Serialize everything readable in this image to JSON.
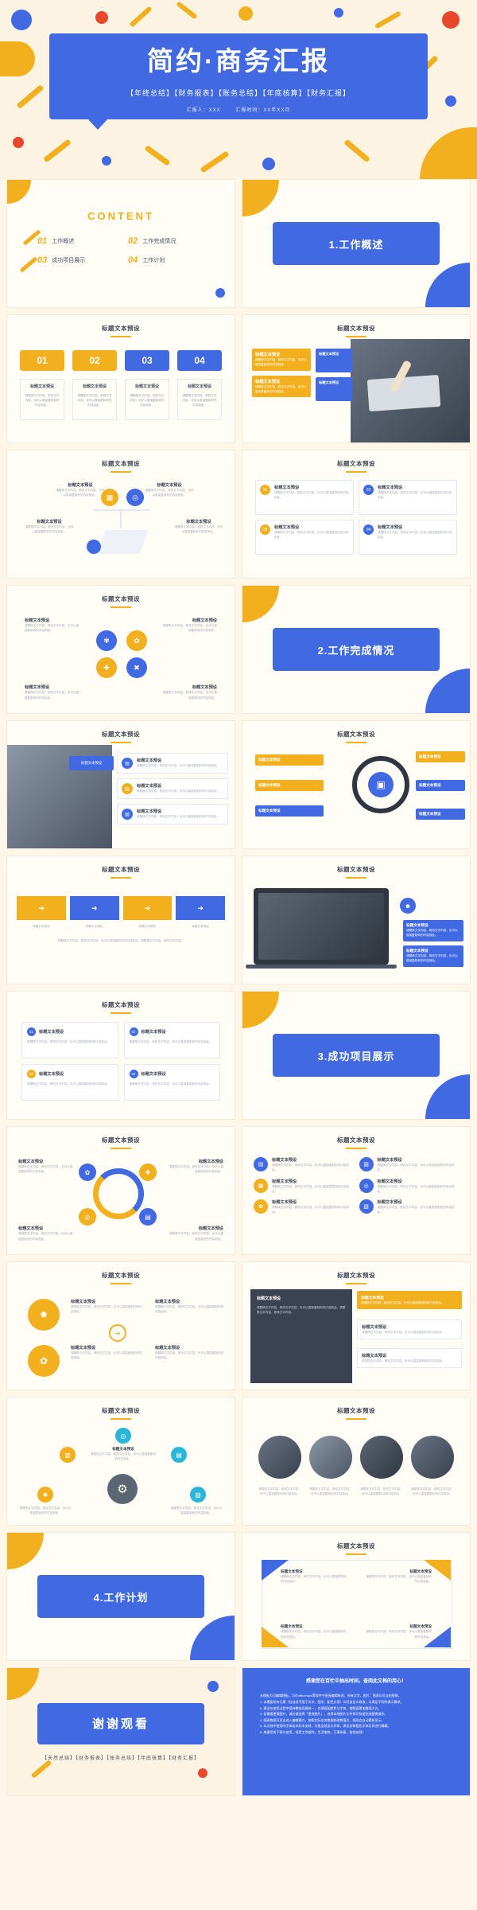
{
  "cover": {
    "title": "简约·商务汇报",
    "subtitle": "【年终总结】【财务报表】【账务总结】【年底核算】【财务汇报】",
    "meta_reporter": "汇报人：XXX",
    "meta_time": "汇报时间：XX年XX月"
  },
  "catalog": {
    "heading": "CONTENT",
    "items": [
      {
        "num": "01",
        "label": "工作概述"
      },
      {
        "num": "02",
        "label": "工作完成情况"
      },
      {
        "num": "03",
        "label": "成功项目展示"
      },
      {
        "num": "04",
        "label": "工作计划"
      }
    ]
  },
  "sections": [
    {
      "label": "1.工作概述"
    },
    {
      "label": "2.工作完成情况"
    },
    {
      "label": "3.成功项目展示"
    },
    {
      "label": "4.工作计划"
    }
  ],
  "slide_title": "标题文本预设",
  "body_text": "请替换文字内容，修改文字内容，也可以直接复制你的内容到此。请替换文字内容，修改文字内容。",
  "body_text_short": "请替换文字内容，修改文字内容，也可以直接复制你的内容到此。",
  "numbered": {
    "cards": [
      {
        "num": "01",
        "color": "#f2b01e",
        "label": "标题文本预设"
      },
      {
        "num": "02",
        "color": "#f2b01e",
        "label": "标题文本预设"
      },
      {
        "num": "03",
        "color": "#4069e2",
        "label": "标题文本预设"
      },
      {
        "num": "04",
        "color": "#4069e2",
        "label": "标题文本预设"
      }
    ]
  },
  "list_items": [
    {
      "num": "01",
      "label": "标题文本预设"
    },
    {
      "num": "02",
      "label": "标题文本预设"
    },
    {
      "num": "03",
      "label": "标题文本预设"
    },
    {
      "num": "04",
      "label": "标题文本预设"
    }
  ],
  "icons": {
    "chart": "chart-icon",
    "target": "target-icon",
    "gear": "gear-icon",
    "bulb": "bulb-icon",
    "cart": "cart-icon",
    "doc": "document-icon",
    "user": "user-icon",
    "lock": "lock-icon",
    "bank": "bank-icon",
    "arrow": "arrow-right-icon"
  },
  "thanks": {
    "title": "谢谢观看",
    "subtitle": "【天然总结】【财务报表】【账务总结】【年底核算】【财务汇报】"
  },
  "terms": {
    "heading": "感谢您在百忙中抽出时间，查阅此文档的用心！",
    "lines": [
      "本模板为可编辑模板，可在office/wps等软件中直接编辑修改，所有文字、图片、图表均可自由替换。",
      "1. 本模板所有元素（包括但不限于文字、图形、配色方案）均可自定义修改，以满足不同的演示需求。",
      "2. 建议在使用过程中保持整体风格统一，合理搭配颜色与字体，使版面更加美观大方。",
      "3. 若需要更换图片，请右键选择「更改图片」，选择本地图片文件即可快速完成替换操作。",
      "4. 图表数据可双击进入编辑模式，按照实际业务数据修改数值后，图形会自动更新显示。",
      "5. 本文档中使用的字体若本机未安装，可能出现显示异常，建议安装相应字体后再进行编辑。",
      "6. 感谢您的下载与使用，祝您工作顺利，生活愉快，万事如意，前程似锦！"
    ]
  },
  "colors": {
    "blue": "#4069e2",
    "yellow": "#f2b01e",
    "red": "#e8472c",
    "cream": "#fdf3e2"
  }
}
